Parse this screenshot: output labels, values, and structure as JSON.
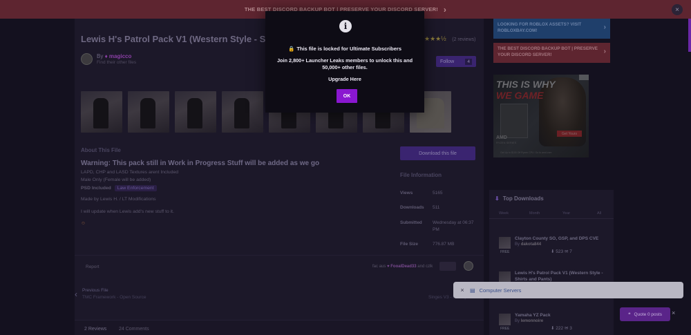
{
  "top_banner": {
    "text": "THE BEST DISCORD BACKUP BOT | PRESERVE YOUR DISCORD SERVER!",
    "chev": "›",
    "close": "×"
  },
  "file": {
    "title": "Lewis H's Patrol Pack V1 (Western Style - Shirts a",
    "stars": "★★★½",
    "reviews_count": "(2 reviews)",
    "author_prefix": "By",
    "author_name": "magicco",
    "author_sub": "Find their other files",
    "follow_label": "Follow",
    "follow_count": "4"
  },
  "about": {
    "heading": "About This File",
    "warning": "Warning: This pack still in Work in Progress Stuff will be added as we go",
    "lines": [
      "LAPD, CHP and LASD Textures arent Included",
      "Male Only (Female will be added)"
    ],
    "psd_label": "PSD Included",
    "tag": "Law Enforcement",
    "made_by": "Made by Lewis H. / LT Modifications",
    "update_note": "I will update when Lewis add's new stuff to it."
  },
  "download_button": "Download this file",
  "file_info": {
    "heading": "File Information",
    "rows": [
      {
        "key": "Views",
        "value": "5165"
      },
      {
        "key": "Downloads",
        "value": "511"
      },
      {
        "key": "Submitted",
        "value": "Wednesday at 06:37 PM"
      },
      {
        "key": "File Size",
        "value": "776.87 MB"
      }
    ]
  },
  "report": "Report",
  "liked_by": {
    "prefix": "fac aus",
    "name": "FooalDead33",
    "suffix": "and czlk"
  },
  "prev_file": {
    "label": "Previous File",
    "sub": "TMC Framework - Open Source",
    "right": "Singes V3 - File Update"
  },
  "tabs": [
    "2 Reviews",
    "24 Comments"
  ],
  "sidebar": {
    "blue_btn": "LOOKING FOR ROBLOX ASSETS? VISIT ROBLOXBAY.COM!",
    "red_btn": "THE BEST DISCORD BACKUP BOT | PRESERVE YOUR DISCORD SERVER!",
    "ad": {
      "t1": "THIS IS WHY",
      "t2": "WE GAME",
      "amd": "AMD",
      "amd_sub": "RYZEN SERIES",
      "cta": "Get Yours",
      "foot": "Get Up to $100 Off Ryzen CPU. Go to amd.com"
    },
    "top_downloads": {
      "heading": "Top Downloads",
      "periods": [
        "Week",
        "Month",
        "Year",
        "All"
      ],
      "items": [
        {
          "title": "Clayton County SO, GSP, and DPS CVE",
          "by": "By",
          "author": "dakota844",
          "free": "FREE",
          "downloads": "523",
          "comments": "7"
        },
        {
          "title": "Lewis H's Patrol Pack V1 (Western Style - Shirts and Pants)",
          "by": "",
          "author": "",
          "free": "",
          "downloads": "",
          "comments": ""
        },
        {
          "title": "Yamaha YZ Pack",
          "by": "By",
          "author": "lemonnoire",
          "free": "FREE",
          "downloads": "222",
          "comments": "3"
        }
      ]
    }
  },
  "modal": {
    "icon": "i",
    "locked": "This file is locked for Ultimate Subscribers",
    "join": "Join 2,800+ Launcher Leaks members to unlock this and 50,000+ other files.",
    "upgrade": "Upgrade Here",
    "ok": "OK"
  },
  "computer_servers": {
    "close": "×",
    "label": "Computer Servers"
  },
  "quote_posts": "Quote 0 posts",
  "quote_close": "×",
  "colors": {
    "accent": "#8a17d0",
    "banner": "#5e2530",
    "blue_btn": "#1f3f6b"
  }
}
